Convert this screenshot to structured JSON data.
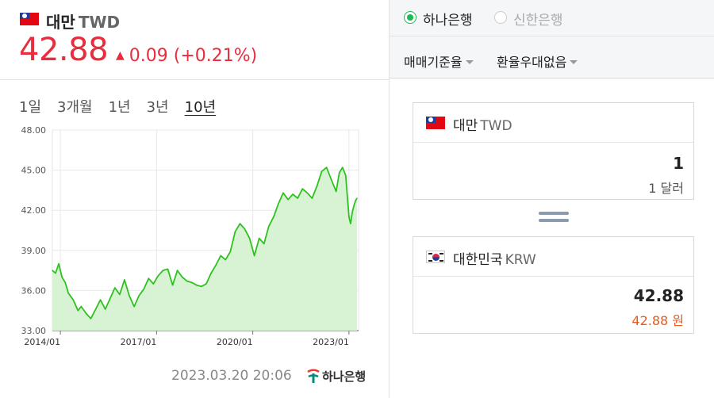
{
  "currency": {
    "name": "대만",
    "code": "TWD",
    "price": "42.88",
    "change": "0.09 (+0.21%)",
    "change_color": "#e82d3e"
  },
  "periods": [
    "1일",
    "3개월",
    "1년",
    "3년",
    "10년"
  ],
  "active_period": "10년",
  "timestamp": "2023.03.20 20:06",
  "source_logo": "하나은행",
  "banks": [
    {
      "label": "하나은행",
      "selected": true
    },
    {
      "label": "신한은행",
      "selected": false
    }
  ],
  "options": {
    "rate_type": "매매기준율",
    "preferential": "환율우대없음"
  },
  "converter": {
    "from": {
      "name": "대만",
      "code": "TWD",
      "amount": "1",
      "text": "1 달러"
    },
    "to": {
      "name": "대한민국",
      "code": "KRW",
      "amount": "42.88",
      "text": "42.88 원",
      "text_color": "#e85a1e"
    }
  },
  "icons": [
    "taiwan-flag-icon",
    "korea-flag-icon",
    "up-triangle-icon",
    "equals-icon",
    "caret-down-icon",
    "hana-bank-logo-icon"
  ],
  "chart_data": {
    "type": "area",
    "x_ticks": [
      "2014/01",
      "2017/01",
      "2020/01",
      "2023/01"
    ],
    "y_ticks": [
      "48.00",
      "45.00",
      "42.00",
      "39.00",
      "36.00",
      "33.00"
    ],
    "ylim": [
      33,
      48
    ],
    "x_range": [
      2013.75,
      2023.3
    ],
    "grid": true,
    "line_color": "#2ec11f",
    "fill_color": "#d7f3d4",
    "series": [
      {
        "x": [
          2013.75,
          2013.85,
          2013.95,
          2014.05,
          2014.15,
          2014.25,
          2014.4,
          2014.55,
          2014.65,
          2014.8,
          2014.95,
          2015.1,
          2015.25,
          2015.4,
          2015.55,
          2015.7,
          2015.85,
          2016.0,
          2016.15,
          2016.3,
          2016.45,
          2016.6,
          2016.75,
          2016.9,
          2017.05,
          2017.2,
          2017.35,
          2017.5,
          2017.65,
          2017.8,
          2017.95,
          2018.1,
          2018.25,
          2018.4,
          2018.55,
          2018.7,
          2018.85,
          2019.0,
          2019.15,
          2019.3,
          2019.45,
          2019.6,
          2019.75,
          2019.9,
          2020.05,
          2020.2,
          2020.35,
          2020.5,
          2020.65,
          2020.8,
          2020.95,
          2021.1,
          2021.25,
          2021.4,
          2021.55,
          2021.7,
          2021.85,
          2022.0,
          2022.15,
          2022.3,
          2022.45,
          2022.6,
          2022.7,
          2022.8,
          2022.9,
          2022.95,
          2023.0,
          2023.05,
          2023.1,
          2023.15,
          2023.2,
          2023.25
        ],
        "values": [
          37.5,
          37.3,
          38.0,
          37.0,
          36.6,
          35.8,
          35.3,
          34.5,
          34.8,
          34.3,
          33.9,
          34.6,
          35.3,
          34.6,
          35.4,
          36.2,
          35.7,
          36.8,
          35.6,
          34.8,
          35.6,
          36.1,
          36.9,
          36.5,
          37.1,
          37.5,
          37.6,
          36.4,
          37.5,
          37.0,
          36.7,
          36.6,
          36.4,
          36.3,
          36.5,
          37.3,
          37.9,
          38.6,
          38.3,
          38.9,
          40.4,
          41.0,
          40.6,
          39.9,
          38.6,
          39.9,
          39.5,
          40.8,
          41.5,
          42.5,
          43.3,
          42.8,
          43.2,
          42.9,
          43.6,
          43.3,
          42.9,
          43.8,
          44.9,
          45.2,
          44.3,
          43.4,
          44.8,
          45.2,
          44.6,
          43.0,
          41.5,
          41.0,
          41.8,
          42.3,
          42.7,
          42.9
        ]
      }
    ]
  }
}
